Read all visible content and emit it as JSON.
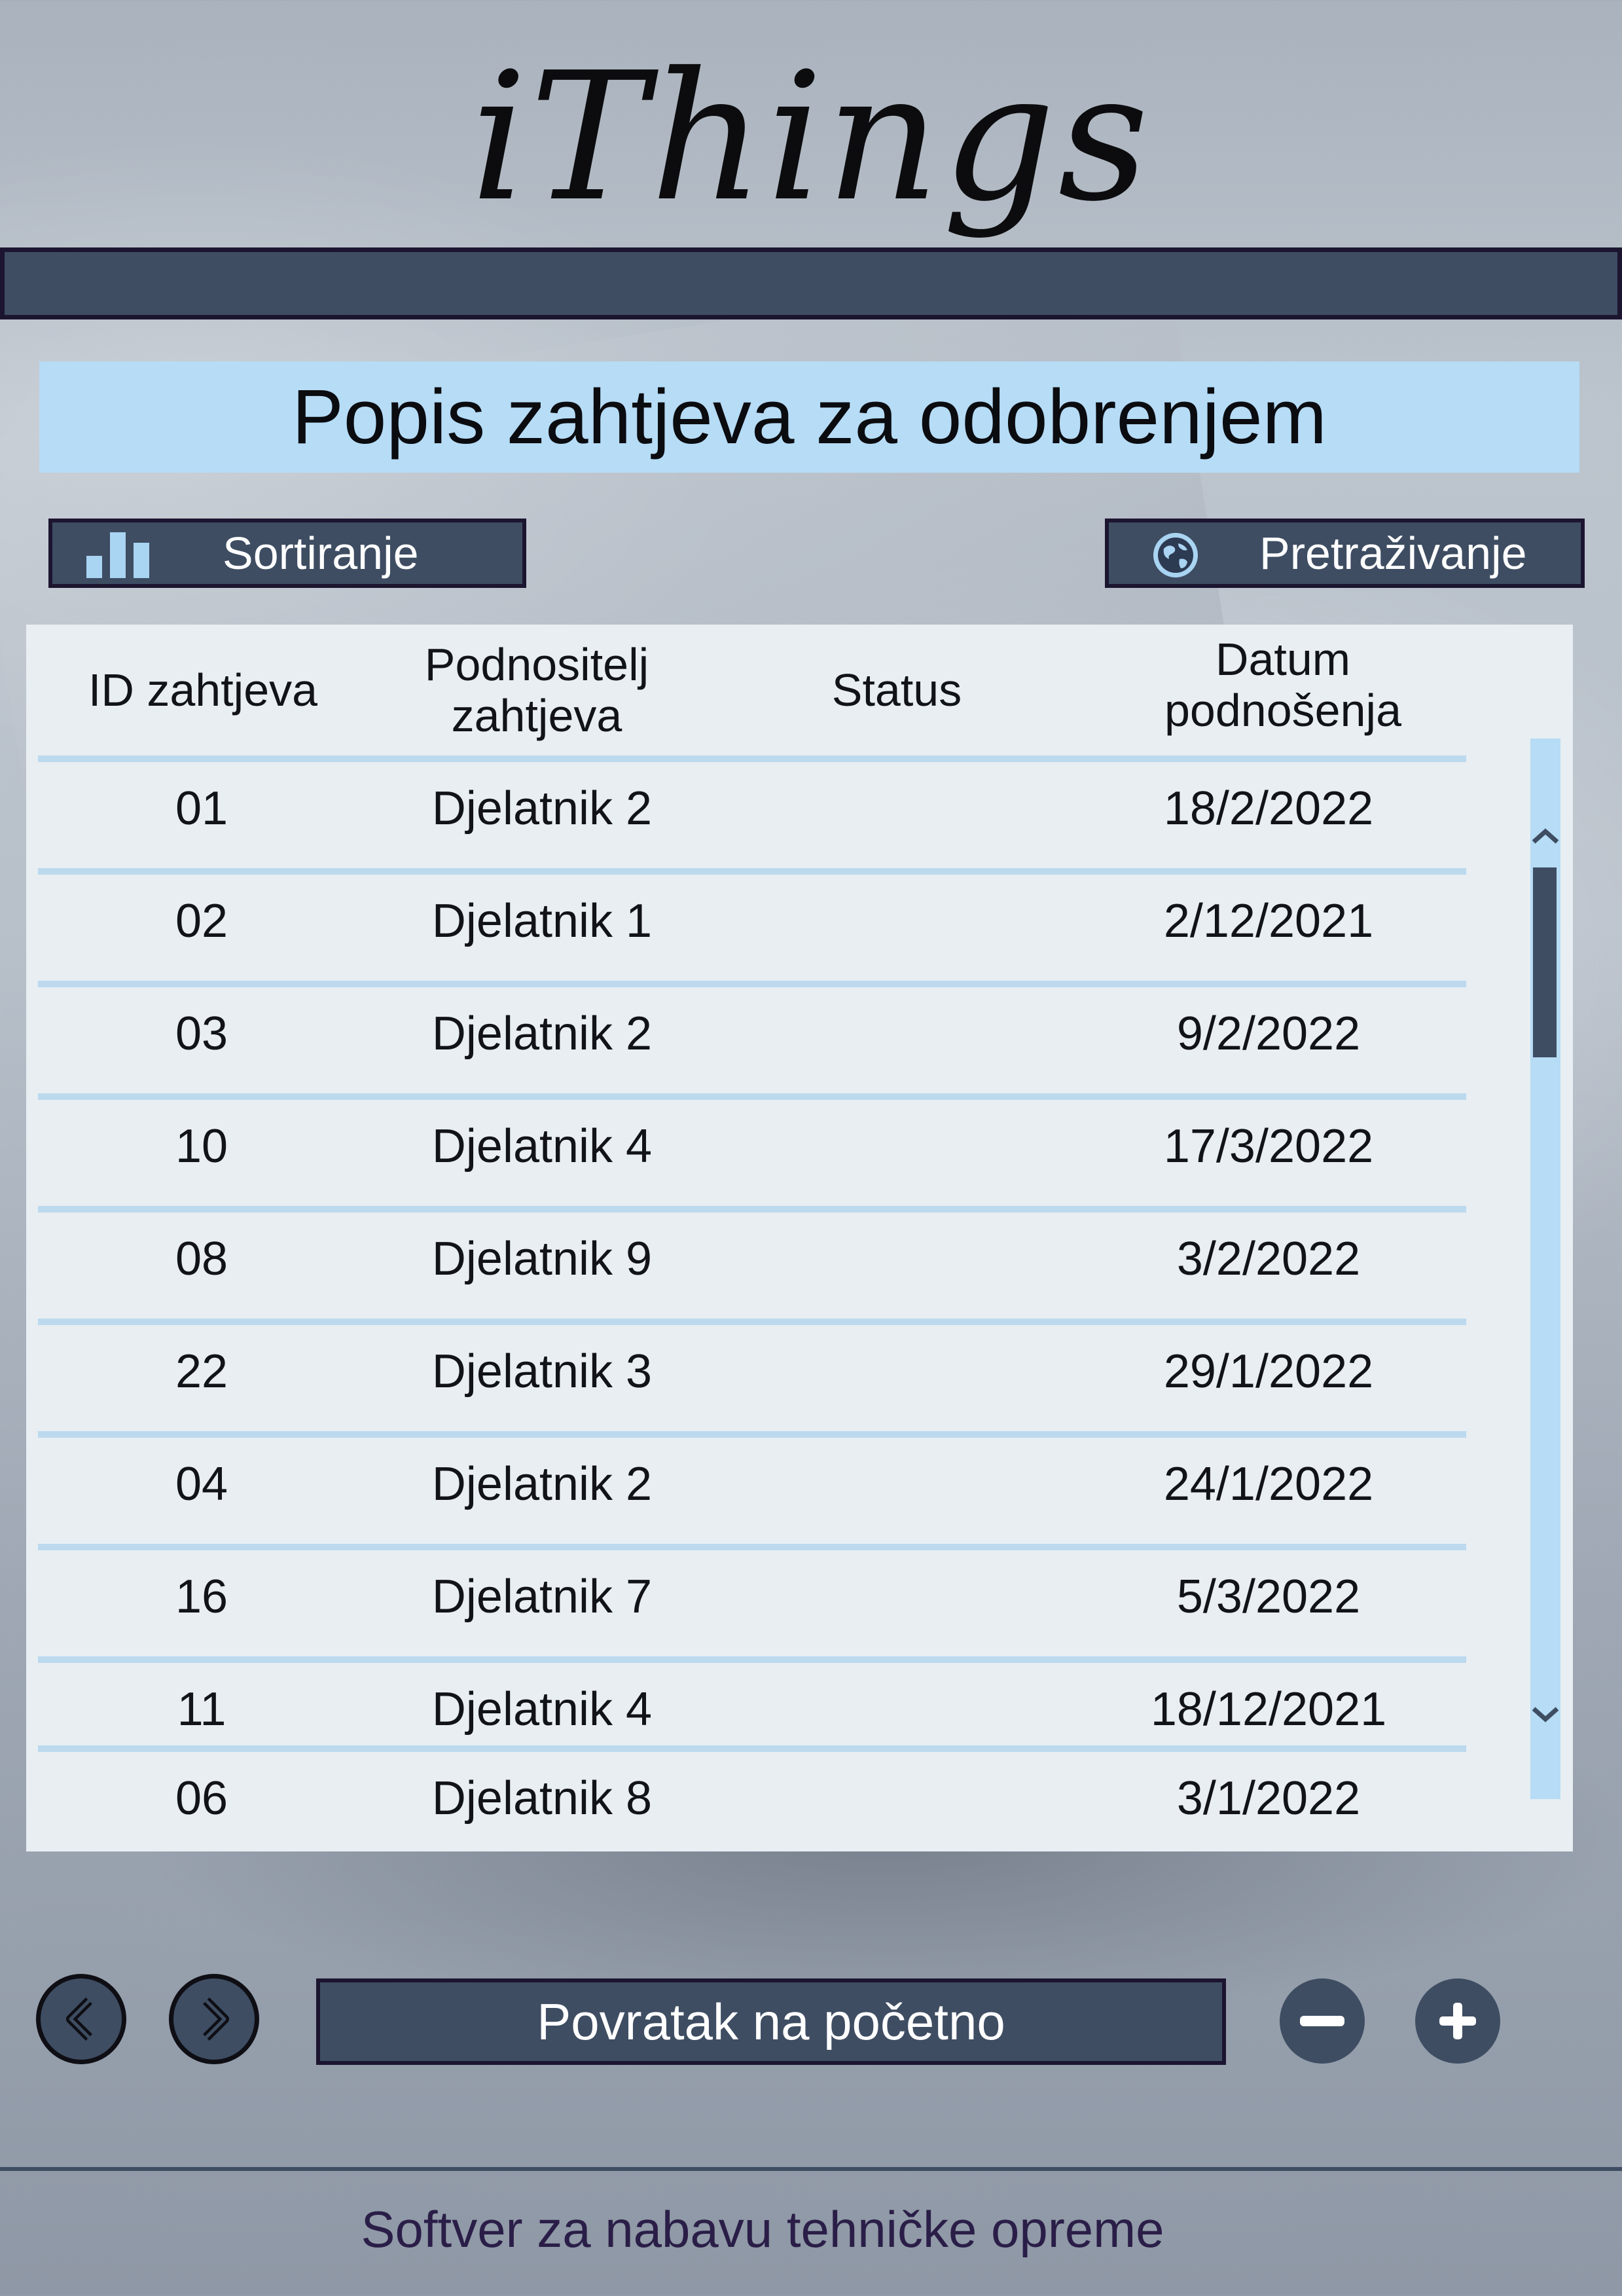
{
  "app": {
    "logo_text": "iThings"
  },
  "page": {
    "title": "Popis zahtjeva za odobrenjem"
  },
  "toolbar": {
    "sort_label": "Sortiranje",
    "sort_icon": "bar-chart-icon",
    "search_label": "Pretraživanje",
    "search_icon": "globe-icon"
  },
  "table": {
    "headers": {
      "id": "ID zahtjeva",
      "submitter": "Podnositelj zahtjeva",
      "status": "Status",
      "date": "Datum podnošenja"
    },
    "rows": [
      {
        "id": "01",
        "submitter": "Djelatnik 2",
        "status": "",
        "date": "18/2/2022"
      },
      {
        "id": "02",
        "submitter": "Djelatnik 1",
        "status": "",
        "date": "2/12/2021"
      },
      {
        "id": "03",
        "submitter": "Djelatnik 2",
        "status": "",
        "date": "9/2/2022"
      },
      {
        "id": "10",
        "submitter": "Djelatnik 4",
        "status": "",
        "date": "17/3/2022"
      },
      {
        "id": "08",
        "submitter": "Djelatnik 9",
        "status": "",
        "date": "3/2/2022"
      },
      {
        "id": "22",
        "submitter": "Djelatnik 3",
        "status": "",
        "date": "29/1/2022"
      },
      {
        "id": "04",
        "submitter": "Djelatnik 2",
        "status": "",
        "date": "24/1/2022"
      },
      {
        "id": "16",
        "submitter": "Djelatnik 7",
        "status": "",
        "date": "5/3/2022"
      },
      {
        "id": "11",
        "submitter": "Djelatnik 4",
        "status": "",
        "date": "18/12/2021"
      },
      {
        "id": "06",
        "submitter": "Djelatnik 8",
        "status": "",
        "date": "3/1/2022"
      }
    ]
  },
  "navigation": {
    "back_icon": "chevron-left-icon",
    "forward_icon": "chevron-right-icon",
    "home_label": "Povratak na početno",
    "zoom_out_icon": "minus-icon",
    "zoom_in_icon": "plus-icon"
  },
  "footer": {
    "tagline": "Softver za nabavu tehničke opreme"
  },
  "colors": {
    "primary": "#3e4d62",
    "accent": "#b6dcf6",
    "border": "#1c1530",
    "table_bg": "#e8eef2"
  }
}
